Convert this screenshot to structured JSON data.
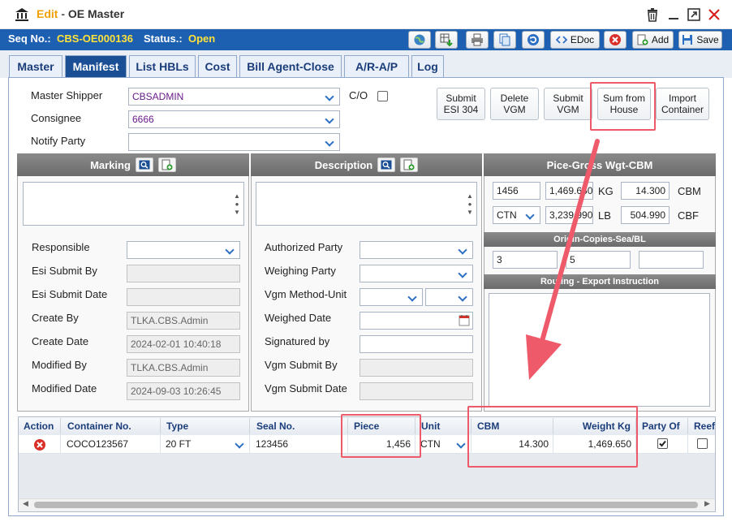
{
  "window": {
    "edit_label": "Edit",
    "separator": " - ",
    "title": "OE Master"
  },
  "header": {
    "seq_label": "Seq No.:",
    "seq_value": "CBS-OE000136",
    "status_label": "Status.:",
    "status_value": "Open",
    "buttons": {
      "edoc": "EDoc",
      "add": "Add",
      "save": "Save"
    }
  },
  "tabs": [
    "Master",
    "Manifest",
    "List HBLs",
    "Cost",
    "Bill Agent-Close",
    "A/R-A/P",
    "Log"
  ],
  "active_tab": "Manifest",
  "parties": {
    "master_shipper_label": "Master Shipper",
    "master_shipper_value": "CBSADMIN",
    "consignee_label": "Consignee",
    "consignee_value": "6666",
    "notify_party_label": "Notify Party",
    "notify_party_value": "",
    "co_label": "C/O"
  },
  "action_buttons": {
    "submit_esi": "Submit\nESI 304",
    "delete_vgm": "Delete\nVGM",
    "submit_vgm": "Submit\nVGM",
    "sum_from_house": "Sum from\nHouse",
    "import_container": "Import\nContainer"
  },
  "marking": {
    "title": "Marking"
  },
  "description": {
    "title": "Description"
  },
  "pice": {
    "title": "Pice-Gross Wgt-CBM",
    "piece": "1456",
    "weight_kg": "1,469.650",
    "kg_unit": "KG",
    "cbm": "14.300",
    "cbm_unit": "CBM",
    "package_unit": "CTN",
    "weight_lb": "3,239.990",
    "lb_unit": "LB",
    "cbf": "504.990",
    "cbf_unit": "CBF"
  },
  "origin": {
    "title": "Origin-Copies-Sea/BL",
    "origin": "3",
    "copies": "5",
    "sea_bl": ""
  },
  "routing": {
    "title": "Routing - Export Instruction"
  },
  "left_fields": {
    "responsible_label": "Responsible",
    "responsible_value": "",
    "esi_submit_by_label": "Esi Submit By",
    "esi_submit_by_value": "",
    "esi_submit_date_label": "Esi Submit Date",
    "esi_submit_date_value": "",
    "create_by_label": "Create By",
    "create_by_value": "TLKA.CBS.Admin",
    "create_date_label": "Create Date",
    "create_date_value": "2024-02-01 10:40:18",
    "modified_by_label": "Modified By",
    "modified_by_value": "TLKA.CBS.Admin",
    "modified_date_label": "Modified Date",
    "modified_date_value": "2024-09-03 10:26:45"
  },
  "mid_fields": {
    "authorized_party_label": "Authorized Party",
    "weighing_party_label": "Weighing Party",
    "vgm_method_unit_label": "Vgm Method-Unit",
    "weighed_date_label": "Weighed Date",
    "signatured_by_label": "Signatured by",
    "vgm_submit_by_label": "Vgm Submit By",
    "vgm_submit_date_label": "Vgm Submit Date"
  },
  "grid": {
    "columns": [
      "Action",
      "Container No.",
      "Type",
      "Seal No.",
      "Piece",
      "Unit",
      "CBM",
      "Weight Kg",
      "Party Of",
      "Reefer"
    ],
    "rows": [
      {
        "container_no": "COCO123567",
        "type": "20 FT",
        "seal_no": "123456",
        "piece": "1,456",
        "unit": "CTN",
        "cbm": "14.300",
        "weight_kg": "1,469.650",
        "party_of": true,
        "reefer": false
      }
    ]
  },
  "colors": {
    "accent": "#1d5fb0",
    "highlight": "#ee5a6a",
    "status": "#ffe23a"
  }
}
